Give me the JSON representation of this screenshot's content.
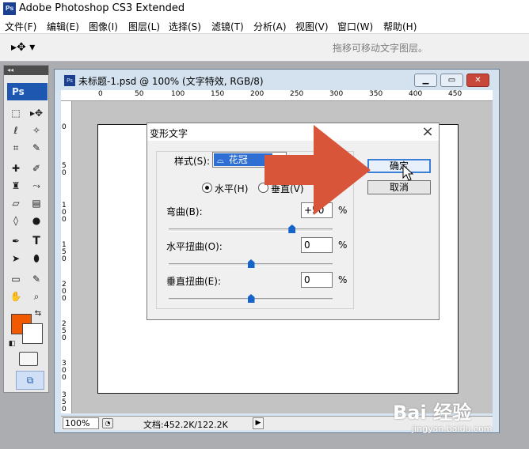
{
  "app": {
    "title": "Adobe Photoshop CS3 Extended",
    "logo": "Ps"
  },
  "menu": [
    "文件(F)",
    "编辑(E)",
    "图像(I)",
    "图层(L)",
    "选择(S)",
    "滤镜(T)",
    "分析(A)",
    "视图(V)",
    "窗口(W)",
    "帮助(H)"
  ],
  "options_bar": {
    "tool_icon": "move-tool-icon",
    "hint": "拖移可移动文字图层。"
  },
  "toolbox": {
    "header": "◂◂",
    "logo": "Ps",
    "fg_color": "#f15a00",
    "bg_color": "#ffffff"
  },
  "document": {
    "title": "未标题-1.psd @ 100% (文字特效, RGB/8)",
    "ruler_top": [
      "0",
      "50",
      "100",
      "150",
      "200",
      "250",
      "300",
      "350",
      "400",
      "450"
    ],
    "ruler_left": [
      "0",
      "5\n0",
      "1\n0\n0",
      "1\n5\n0",
      "2\n0\n0",
      "2\n5\n0",
      "3\n0\n0",
      "3\n5\n0"
    ],
    "zoom": "100%",
    "info": "文档:452.2K/122.2K"
  },
  "dialog": {
    "title": "变形文字",
    "style_label": "样式(S):",
    "style_value": "花冠",
    "horizontal_label": "水平(H)",
    "vertical_label": "垂直(V)",
    "orientation": "horizontal",
    "bend_label": "弯曲(B):",
    "bend_value": "+50",
    "bend_level": 0.75,
    "hdist_label": "水平扭曲(O):",
    "hdist_value": "0",
    "hdist_level": 0.5,
    "vdist_label": "垂直扭曲(E):",
    "vdist_value": "0",
    "vdist_level": 0.5,
    "percent": "%",
    "ok_label": "确定",
    "cancel_label": "取消"
  },
  "annotation": {
    "arrow_color": "#d9553a"
  },
  "watermark": {
    "main": "Bai 经验",
    "sub": "jingyan.baidu.com"
  }
}
